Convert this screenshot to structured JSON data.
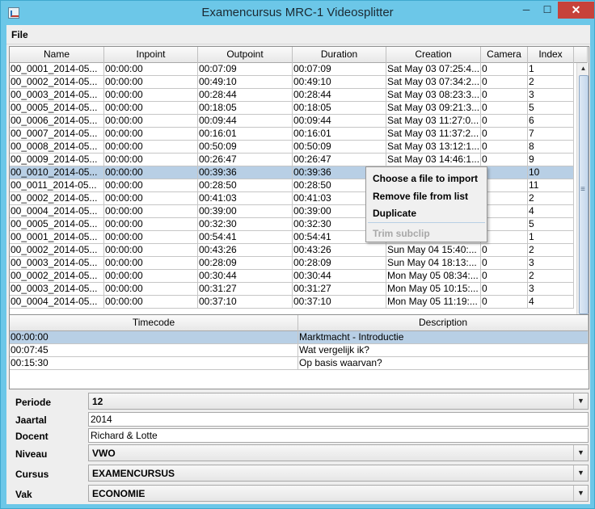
{
  "window": {
    "title": "Examencursus MRC-1 Videosplitter",
    "minimize_glyph": "─",
    "maximize_glyph": "☐",
    "close_glyph": "✕"
  },
  "menu": {
    "file": "File"
  },
  "main_table": {
    "columns": [
      "Name",
      "Inpoint",
      "Outpoint",
      "Duration",
      "Creation",
      "Camera",
      "Index"
    ],
    "rows": [
      {
        "name": "00_0001_2014-05...",
        "inpoint": "00:00:00",
        "outpoint": "00:07:09",
        "duration": "00:07:09",
        "creation": "Sat May 03 07:25:4...",
        "camera": "0",
        "index": "1"
      },
      {
        "name": "00_0002_2014-05...",
        "inpoint": "00:00:00",
        "outpoint": "00:49:10",
        "duration": "00:49:10",
        "creation": "Sat May 03 07:34:2...",
        "camera": "0",
        "index": "2"
      },
      {
        "name": "00_0003_2014-05...",
        "inpoint": "00:00:00",
        "outpoint": "00:28:44",
        "duration": "00:28:44",
        "creation": "Sat May 03 08:23:3...",
        "camera": "0",
        "index": "3"
      },
      {
        "name": "00_0005_2014-05...",
        "inpoint": "00:00:00",
        "outpoint": "00:18:05",
        "duration": "00:18:05",
        "creation": "Sat May 03 09:21:3...",
        "camera": "0",
        "index": "5"
      },
      {
        "name": "00_0006_2014-05...",
        "inpoint": "00:00:00",
        "outpoint": "00:09:44",
        "duration": "00:09:44",
        "creation": "Sat May 03 11:27:0...",
        "camera": "0",
        "index": "6"
      },
      {
        "name": "00_0007_2014-05...",
        "inpoint": "00:00:00",
        "outpoint": "00:16:01",
        "duration": "00:16:01",
        "creation": "Sat May 03 11:37:2...",
        "camera": "0",
        "index": "7"
      },
      {
        "name": "00_0008_2014-05...",
        "inpoint": "00:00:00",
        "outpoint": "00:50:09",
        "duration": "00:50:09",
        "creation": "Sat May 03 13:12:1...",
        "camera": "0",
        "index": "8"
      },
      {
        "name": "00_0009_2014-05...",
        "inpoint": "00:00:00",
        "outpoint": "00:26:47",
        "duration": "00:26:47",
        "creation": "Sat May 03 14:46:1...",
        "camera": "0",
        "index": "9"
      },
      {
        "name": "00_0010_2014-05...",
        "inpoint": "00:00:00",
        "outpoint": "00:39:36",
        "duration": "00:39:36",
        "creation": "",
        "camera": "",
        "index": "10"
      },
      {
        "name": "00_0011_2014-05...",
        "inpoint": "00:00:00",
        "outpoint": "00:28:50",
        "duration": "00:28:50",
        "creation": "",
        "camera": "",
        "index": "11"
      },
      {
        "name": "00_0002_2014-05...",
        "inpoint": "00:00:00",
        "outpoint": "00:41:03",
        "duration": "00:41:03",
        "creation": "",
        "camera": "",
        "index": "2"
      },
      {
        "name": "00_0004_2014-05...",
        "inpoint": "00:00:00",
        "outpoint": "00:39:00",
        "duration": "00:39:00",
        "creation": "",
        "camera": "",
        "index": "4"
      },
      {
        "name": "00_0005_2014-05...",
        "inpoint": "00:00:00",
        "outpoint": "00:32:30",
        "duration": "00:32:30",
        "creation": "",
        "camera": "",
        "index": "5"
      },
      {
        "name": "00_0001_2014-05...",
        "inpoint": "00:00:00",
        "outpoint": "00:54:41",
        "duration": "00:54:41",
        "creation": "",
        "camera": "",
        "index": "1"
      },
      {
        "name": "00_0002_2014-05...",
        "inpoint": "00:00:00",
        "outpoint": "00:43:26",
        "duration": "00:43:26",
        "creation": "Sun May 04 15:40:...",
        "camera": "0",
        "index": "2"
      },
      {
        "name": "00_0003_2014-05...",
        "inpoint": "00:00:00",
        "outpoint": "00:28:09",
        "duration": "00:28:09",
        "creation": "Sun May 04 18:13:...",
        "camera": "0",
        "index": "3"
      },
      {
        "name": "00_0002_2014-05...",
        "inpoint": "00:00:00",
        "outpoint": "00:30:44",
        "duration": "00:30:44",
        "creation": "Mon May 05 08:34:...",
        "camera": "0",
        "index": "2"
      },
      {
        "name": "00_0003_2014-05...",
        "inpoint": "00:00:00",
        "outpoint": "00:31:27",
        "duration": "00:31:27",
        "creation": "Mon May 05 10:15:...",
        "camera": "0",
        "index": "3"
      },
      {
        "name": "00_0004_2014-05...",
        "inpoint": "00:00:00",
        "outpoint": "00:37:10",
        "duration": "00:37:10",
        "creation": "Mon May 05 11:19:...",
        "camera": "0",
        "index": "4"
      }
    ],
    "selected_row": 8,
    "scroll_up_glyph": "▲",
    "scroll_down_glyph": "▼"
  },
  "context_menu": {
    "items": [
      {
        "label": "Choose a file to import",
        "enabled": true
      },
      {
        "label": "Remove file from list",
        "enabled": true
      },
      {
        "label": "Duplicate",
        "enabled": true
      },
      {
        "label": "Trim subclip",
        "enabled": false
      }
    ]
  },
  "timecode_table": {
    "columns": [
      "Timecode",
      "Description"
    ],
    "rows": [
      {
        "timecode": "00:00:00",
        "description": "Marktmacht - Introductie"
      },
      {
        "timecode": "00:07:45",
        "description": "Wat vergelijk ik?"
      },
      {
        "timecode": "00:15:30",
        "description": "Op basis waarvan?"
      }
    ],
    "selected_row": 0
  },
  "form": {
    "periode": {
      "label": "Periode",
      "value": "12"
    },
    "jaartal": {
      "label": "Jaartal",
      "value": "2014"
    },
    "docent": {
      "label": "Docent",
      "value": "Richard & Lotte"
    },
    "niveau": {
      "label": "Niveau",
      "value": "VWO"
    },
    "cursus": {
      "label": "Cursus",
      "value": "EXAMENCURSUS"
    },
    "vak": {
      "label": "Vak",
      "value": "ECONOMIE"
    },
    "dropdown_glyph": "▼"
  },
  "colors": {
    "title_bar": "#6cc7e8",
    "selection": "#b8cfe5",
    "close_button": "#c7423a"
  }
}
